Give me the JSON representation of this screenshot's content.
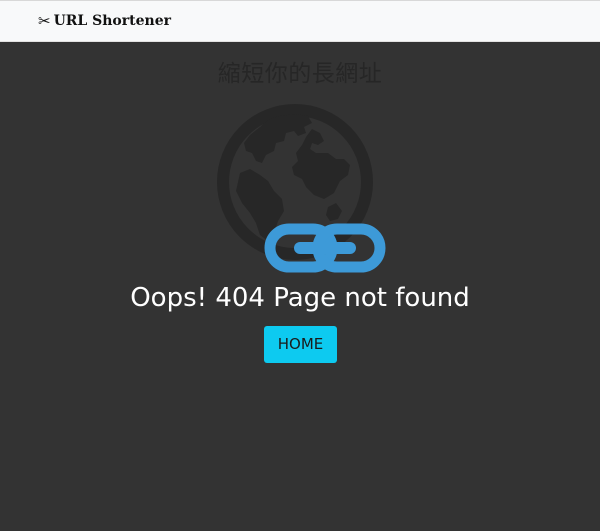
{
  "navbar": {
    "brand_icon": "scissors-icon",
    "brand_text": "URL Shortener"
  },
  "hero": {
    "background_title": "縮短你的長網址",
    "globe_icon": "globe-icon",
    "broken_link_icon": "link-icon"
  },
  "error": {
    "message": "Oops! 404 Page not found",
    "home_button_label": "HOME"
  },
  "colors": {
    "page_background": "#333333",
    "navbar_background": "#f8f9fa",
    "button_background": "#0dcaf0",
    "link_icon": "#3d9ad8",
    "globe": "#272727",
    "error_text": "#ffffff"
  }
}
